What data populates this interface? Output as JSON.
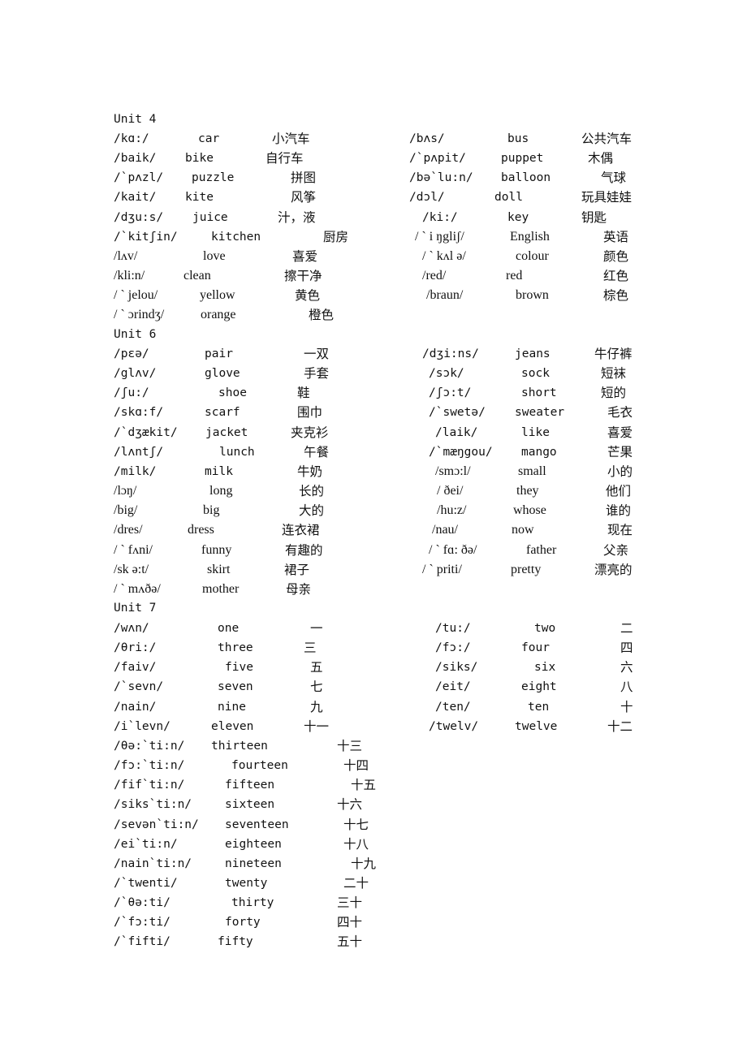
{
  "units": [
    {
      "title": "Unit    4",
      "left": [
        {
          "phonetic": "/kɑ:/",
          "word": "car",
          "meaning": "小汽车"
        },
        {
          "phonetic": "/baik/",
          "word": "bike",
          "meaning": "自行车"
        },
        {
          "phonetic": "/`pʌzl/",
          "word": "puzzle",
          "meaning": "拼图"
        },
        {
          "phonetic": "/kait/",
          "word": "kite",
          "meaning": "风筝"
        },
        {
          "phonetic": "/dʒu:s/",
          "word": "juice",
          "meaning": "汁，液"
        },
        {
          "phonetic": "/`kitʃin/",
          "word": "kitchen",
          "meaning": "厨房"
        },
        {
          "phonetic": "/lʌv/",
          "word": "love",
          "meaning": "喜爱"
        },
        {
          "phonetic": "/kli:n/",
          "word": "clean",
          "meaning": "擦干净"
        },
        {
          "phonetic": "/ ` jelou/",
          "word": "yellow",
          "meaning": "黄色"
        },
        {
          "phonetic": "/ ` ɔrindʒ/",
          "word": "orange",
          "meaning": "橙色"
        }
      ],
      "right": [
        {
          "phonetic": "/bʌs/",
          "word": "bus",
          "meaning": "公共汽车"
        },
        {
          "phonetic": "/`pʌpit/",
          "word": "puppet",
          "meaning": "木偶"
        },
        {
          "phonetic": "/bə`lu:n/",
          "word": "balloon",
          "meaning": "气球"
        },
        {
          "phonetic": "/dɔl/",
          "word": "doll",
          "meaning": "玩具娃娃"
        },
        {
          "phonetic": "/ki:/",
          "word": "key",
          "meaning": "钥匙"
        },
        {
          "phonetic": "/ ` i ŋgliʃ/",
          "word": "English",
          "meaning": "英语"
        },
        {
          "phonetic": "/ ` kʌl ə/",
          "word": "colour",
          "meaning": "颜色"
        },
        {
          "phonetic": "/red/",
          "word": "red",
          "meaning": "红色"
        },
        {
          "phonetic": "/braun/",
          "word": "brown",
          "meaning": "棕色"
        }
      ]
    },
    {
      "title": "Unit    6",
      "left": [
        {
          "phonetic": "/pɛə/",
          "word": "pair",
          "meaning": "一双"
        },
        {
          "phonetic": "/glʌv/",
          "word": "glove",
          "meaning": "手套"
        },
        {
          "phonetic": "/ʃu:/",
          "word": "shoe",
          "meaning": "鞋"
        },
        {
          "phonetic": "/skɑ:f/",
          "word": "scarf",
          "meaning": "围巾"
        },
        {
          "phonetic": "/`dʒækit/",
          "word": "jacket",
          "meaning": "夹克衫"
        },
        {
          "phonetic": "/lʌntʃ/",
          "word": "lunch",
          "meaning": "午餐"
        },
        {
          "phonetic": "/milk/",
          "word": "milk",
          "meaning": "牛奶"
        },
        {
          "phonetic": "/lɔŋ/",
          "word": "long",
          "meaning": "长的"
        },
        {
          "phonetic": "/big/",
          "word": "big",
          "meaning": "大的"
        },
        {
          "phonetic": "/dres/",
          "word": "dress",
          "meaning": "连衣裙"
        },
        {
          "phonetic": "/ ` fʌni/",
          "word": "funny",
          "meaning": "有趣的"
        },
        {
          "phonetic": "/sk ə:t/",
          "word": "skirt",
          "meaning": "裙子"
        },
        {
          "phonetic": "/ ` mʌðə/",
          "word": "mother",
          "meaning": "母亲"
        }
      ],
      "right": [
        {
          "phonetic": "/dʒi:ns/",
          "word": "jeans",
          "meaning": "牛仔裤"
        },
        {
          "phonetic": "/sɔk/",
          "word": "sock",
          "meaning": "短袜"
        },
        {
          "phonetic": "/ʃɔ:t/",
          "word": "short",
          "meaning": "短的"
        },
        {
          "phonetic": "/`swetə/",
          "word": "sweater",
          "meaning": "毛衣"
        },
        {
          "phonetic": "/laik/",
          "word": "like",
          "meaning": "喜爱"
        },
        {
          "phonetic": "/`mæŋgou/",
          "word": "mango",
          "meaning": "芒果"
        },
        {
          "phonetic": "/smɔ:l/",
          "word": "small",
          "meaning": "小的"
        },
        {
          "phonetic": "/ ðei/",
          "word": "they",
          "meaning": "他们"
        },
        {
          "phonetic": "/hu:z/",
          "word": "whose",
          "meaning": "谁的"
        },
        {
          "phonetic": "/nau/",
          "word": "now",
          "meaning": "现在"
        },
        {
          "phonetic": "/ ` fɑ: ðə/",
          "word": "father",
          "meaning": "父亲"
        },
        {
          "phonetic": "/ ` priti/",
          "word": "pretty",
          "meaning": "漂亮的"
        }
      ]
    },
    {
      "title": "Unit    7",
      "left": [
        {
          "phonetic": "/wʌn/",
          "word": "one",
          "meaning": "一"
        },
        {
          "phonetic": "/θri:/",
          "word": "three",
          "meaning": "三"
        },
        {
          "phonetic": "/faiv/",
          "word": "five",
          "meaning": "五"
        },
        {
          "phonetic": "/`sevn/",
          "word": "seven",
          "meaning": "七"
        },
        {
          "phonetic": "/nain/",
          "word": "nine",
          "meaning": "九"
        },
        {
          "phonetic": "/i`levn/",
          "word": "eleven",
          "meaning": "十一"
        },
        {
          "phonetic": "/θə:`ti:n/",
          "word": "thirteen",
          "meaning": "十三"
        },
        {
          "phonetic": "/fɔ:`ti:n/",
          "word": "fourteen",
          "meaning": "十四"
        },
        {
          "phonetic": "/fif`ti:n/",
          "word": "fifteen",
          "meaning": "十五"
        },
        {
          "phonetic": "/siks`ti:n/",
          "word": "sixteen",
          "meaning": "十六"
        },
        {
          "phonetic": "/sevən`ti:n/",
          "word": "seventeen",
          "meaning": "十七"
        },
        {
          "phonetic": "/ei`ti:n/",
          "word": "eighteen",
          "meaning": "十八"
        },
        {
          "phonetic": "/nain`ti:n/",
          "word": "nineteen",
          "meaning": "十九"
        },
        {
          "phonetic": "/`twenti/",
          "word": "twenty",
          "meaning": "二十"
        },
        {
          "phonetic": "/`θə:ti/",
          "word": "thirty",
          "meaning": "三十"
        },
        {
          "phonetic": "/`fɔ:ti/",
          "word": "forty",
          "meaning": "四十"
        },
        {
          "phonetic": "/`fifti/",
          "word": "fifty",
          "meaning": "五十"
        }
      ],
      "right": [
        {
          "phonetic": "/tu:/",
          "word": "two",
          "meaning": "二"
        },
        {
          "phonetic": "/fɔ:/",
          "word": "four",
          "meaning": "四"
        },
        {
          "phonetic": "/siks/",
          "word": "six",
          "meaning": "六"
        },
        {
          "phonetic": "/eit/",
          "word": "eight",
          "meaning": "八"
        },
        {
          "phonetic": "/ten/",
          "word": "ten",
          "meaning": "十"
        },
        {
          "phonetic": "/twelv/",
          "word": "twelve",
          "meaning": "十二"
        }
      ]
    }
  ]
}
